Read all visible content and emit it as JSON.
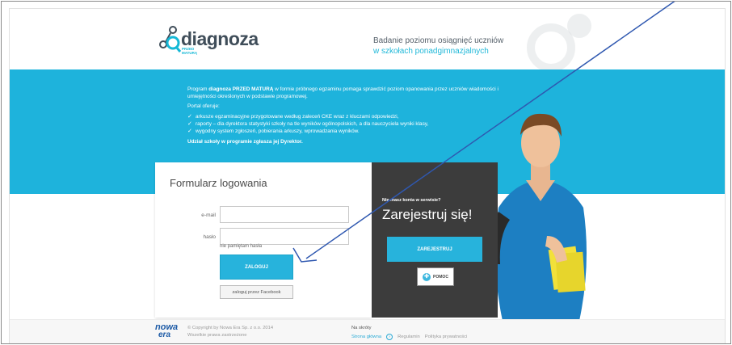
{
  "header": {
    "logo_name": "diagnoza",
    "logo_sub_1": "PRZED",
    "logo_sub_2": "MATURĄ",
    "tagline_1": "Badanie poziomu osiągnięć uczniów",
    "tagline_2": "w szkołach ponadgimnazjalnych"
  },
  "intro": {
    "p1_a": "Program ",
    "p1_b": "diagnoza PRZED MATURĄ",
    "p1_c": " w formie próbnego egzaminu pomaga sprawdzić poziom opanowania przez uczniów wiadomości i umiejętności określonych w podstawie programowej.",
    "offers_label": "Portal oferuje:",
    "items": [
      "arkusze egzaminacyjne przygotowane według zaleceń CKE wraz z kluczami odpowiedzi,",
      "raporty – dla dyrektora statystyki szkoły na tle wyników ogólnopolskich, a dla nauczyciela wyniki klasy,",
      "wygodny system zgłoszeń, pobierania arkuszy, wprowadzania wyników."
    ],
    "footer_note": "Udział szkoły w programie zgłasza jej Dyrektor."
  },
  "login": {
    "title": "Formularz logowania",
    "email_label": "e-mail",
    "password_label": "hasło",
    "email_value": "",
    "password_value": "",
    "forgot": "nie pamiętam hasła",
    "login_button": "ZALOGUJ",
    "facebook_button": "zaloguj przez Facebook"
  },
  "register": {
    "question": "Nie masz konta w serwisie?",
    "title": "Zarejestruj się!",
    "register_button": "ZAREJESTRUJ",
    "help_button": "POMOC"
  },
  "footer": {
    "logo_line1": "nowa",
    "logo_line2": "era",
    "copyright": "© Copyright by Nowa Era Sp. z o.o. 2014",
    "rights": "Wszelkie prawa zastrzeżone",
    "shortcuts_title": "Na skróty",
    "links": [
      "Strona główna",
      "Regulamin",
      "Polityka prywatności"
    ]
  },
  "colors": {
    "accent": "#1eb3dc",
    "dark_panel": "#3c3c3c",
    "annotation_arrow": "#2f58b0"
  },
  "icons": {
    "logo": "magnifier-molecule-icon",
    "check": "checkmark-icon",
    "help": "lifebuoy-icon",
    "home": "home-circle-icon"
  }
}
